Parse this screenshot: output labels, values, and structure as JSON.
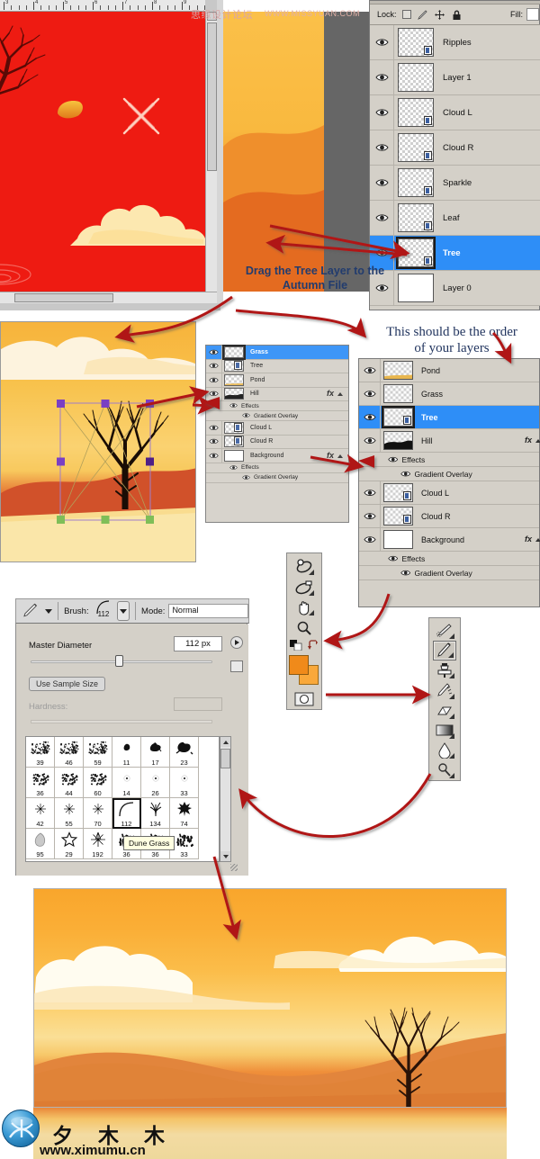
{
  "watermark": {
    "forum": "思缘设计论坛",
    "site": "WWW.MISSYUAN.COM"
  },
  "ruler": {
    "ticks": [
      "3",
      "4",
      "5",
      "6",
      "7",
      "8",
      "9"
    ]
  },
  "layers_panel_top": {
    "lock_label": "Lock:",
    "fill_label": "Fill:",
    "lock_icons": [
      "lock-transparent-icon",
      "lock-image-icon",
      "lock-position-icon",
      "lock-all-icon"
    ],
    "rows": [
      {
        "name": "Ripples",
        "selected": false,
        "mask": true,
        "white": false
      },
      {
        "name": "Layer 1",
        "selected": false,
        "mask": false,
        "white": false
      },
      {
        "name": "Cloud L",
        "selected": false,
        "mask": true,
        "white": false
      },
      {
        "name": "Cloud R",
        "selected": false,
        "mask": true,
        "white": false
      },
      {
        "name": "Sparkle",
        "selected": false,
        "mask": true,
        "white": false
      },
      {
        "name": "Leaf",
        "selected": false,
        "mask": true,
        "white": false
      },
      {
        "name": "Tree",
        "selected": true,
        "mask": true,
        "white": false
      },
      {
        "name": "Layer 0",
        "selected": false,
        "mask": false,
        "white": true
      }
    ]
  },
  "annotations": {
    "drag_tree": "Drag the Tree Layer to the\nAutumn File",
    "drag_tree_line1": "Drag the Tree Layer to the",
    "drag_tree_line2": "Autumn File",
    "order_line1": "This should be the order",
    "order_line2": "of your layers"
  },
  "layers_panel_small": {
    "rows": [
      {
        "name": "Grass",
        "selected": true,
        "kind": "plain",
        "fx": false
      },
      {
        "name": "Tree",
        "selected": false,
        "kind": "mask",
        "fx": false
      },
      {
        "name": "Pond",
        "selected": false,
        "kind": "pond",
        "fx": false
      },
      {
        "name": "Hill",
        "selected": false,
        "kind": "hill",
        "fx": true,
        "effects": [
          "Effects",
          "Gradient Overlay"
        ]
      },
      {
        "name": "Cloud L",
        "selected": false,
        "kind": "mask",
        "fx": false
      },
      {
        "name": "Cloud R",
        "selected": false,
        "kind": "mask",
        "fx": false
      },
      {
        "name": "Background",
        "selected": false,
        "kind": "white",
        "fx": true,
        "effects": [
          "Effects",
          "Gradient Overlay"
        ]
      }
    ]
  },
  "layers_panel_big": {
    "rows": [
      {
        "name": "Pond",
        "selected": false,
        "kind": "pond",
        "fx": false
      },
      {
        "name": "Grass",
        "selected": false,
        "kind": "plain",
        "fx": false
      },
      {
        "name": "Tree",
        "selected": true,
        "kind": "mask",
        "fx": false
      },
      {
        "name": "Hill",
        "selected": false,
        "kind": "hill",
        "fx": true,
        "effects": [
          "Effects",
          "Gradient Overlay"
        ]
      },
      {
        "name": "Cloud L",
        "selected": false,
        "kind": "mask",
        "fx": false
      },
      {
        "name": "Cloud R",
        "selected": false,
        "kind": "mask",
        "fx": false
      },
      {
        "name": "Background",
        "selected": false,
        "kind": "white",
        "fx": true,
        "effects": [
          "Effects",
          "Gradient Overlay"
        ]
      }
    ]
  },
  "brush_options_bar": {
    "brush_label": "Brush:",
    "brush_size": "112",
    "mode_label": "Mode:",
    "mode_value": "Normal"
  },
  "brush_picker": {
    "master_diameter_label": "Master Diameter",
    "master_diameter_value": "112 px",
    "use_sample_size": "Use Sample Size",
    "hardness_label": "Hardness:",
    "hardness_value": "",
    "selected_brush": "112",
    "tooltip": "Dune Grass",
    "presets": [
      {
        "num": "39",
        "ico": "splatter"
      },
      {
        "num": "46",
        "ico": "splatter"
      },
      {
        "num": "59",
        "ico": "splatter"
      },
      {
        "num": "11",
        "ico": "leafsm"
      },
      {
        "num": "17",
        "ico": "leafmd"
      },
      {
        "num": "23",
        "ico": "leaflg"
      },
      {
        "num": "36",
        "ico": "scatter"
      },
      {
        "num": "44",
        "ico": "scatter"
      },
      {
        "num": "60",
        "ico": "scatter"
      },
      {
        "num": "14",
        "ico": "dot"
      },
      {
        "num": "26",
        "ico": "dot"
      },
      {
        "num": "33",
        "ico": "dot"
      },
      {
        "num": "42",
        "ico": "spark"
      },
      {
        "num": "55",
        "ico": "spark"
      },
      {
        "num": "70",
        "ico": "spark"
      },
      {
        "num": "112",
        "ico": "arc"
      },
      {
        "num": "134",
        "ico": "grass"
      },
      {
        "num": "74",
        "ico": "maple"
      },
      {
        "num": "95",
        "ico": "leafsolid"
      },
      {
        "num": "29",
        "ico": "star"
      },
      {
        "num": "192",
        "ico": "burst"
      },
      {
        "num": "36",
        "ico": "dunegrass"
      },
      {
        "num": "36",
        "ico": "dunegrass"
      },
      {
        "num": "33",
        "ico": "dunegrass"
      }
    ]
  },
  "toolbar_bottom": {
    "tools": [
      "3d-rotate-icon",
      "3d-roll-icon",
      "hand-icon",
      "zoom-icon",
      "default-colors-icon",
      "swap-colors-icon",
      "foreground-background-swatch",
      "quick-mask-icon"
    ]
  },
  "toolbar_right": {
    "tools": [
      "healing-brush-icon",
      "brush-icon",
      "clone-stamp-icon",
      "history-brush-icon",
      "eraser-icon",
      "gradient-icon",
      "blur-icon",
      "dodge-icon"
    ],
    "active_tool": "brush-icon"
  },
  "footer": {
    "logo_cn": "夕 木 木",
    "url": "www.ximumu.cn"
  }
}
